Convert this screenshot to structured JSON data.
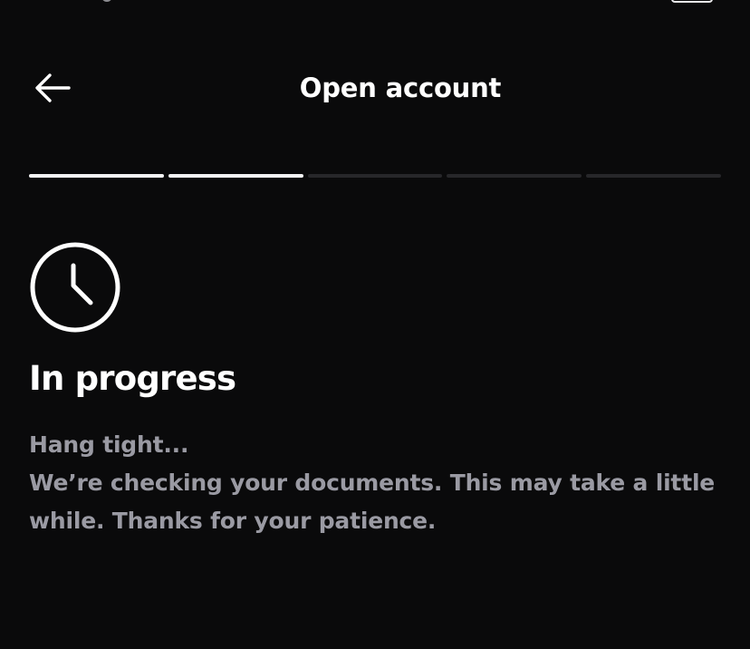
{
  "header": {
    "title": "Open account",
    "back_icon": "arrow-left-icon"
  },
  "progress": {
    "total_steps": 5,
    "completed_steps": 2,
    "active_color": "#f4f4f5",
    "inactive_color": "#27272a"
  },
  "status": {
    "icon": "clock-icon",
    "heading": "In progress",
    "message_line1": "Hang tight...",
    "message_line2": "We’re checking your documents. This may take a little",
    "message_line3": "while. Thanks for your patience."
  },
  "colors": {
    "background": "#0a0a0b",
    "primary_text": "#ffffff",
    "secondary_text": "#9a9aa3"
  }
}
